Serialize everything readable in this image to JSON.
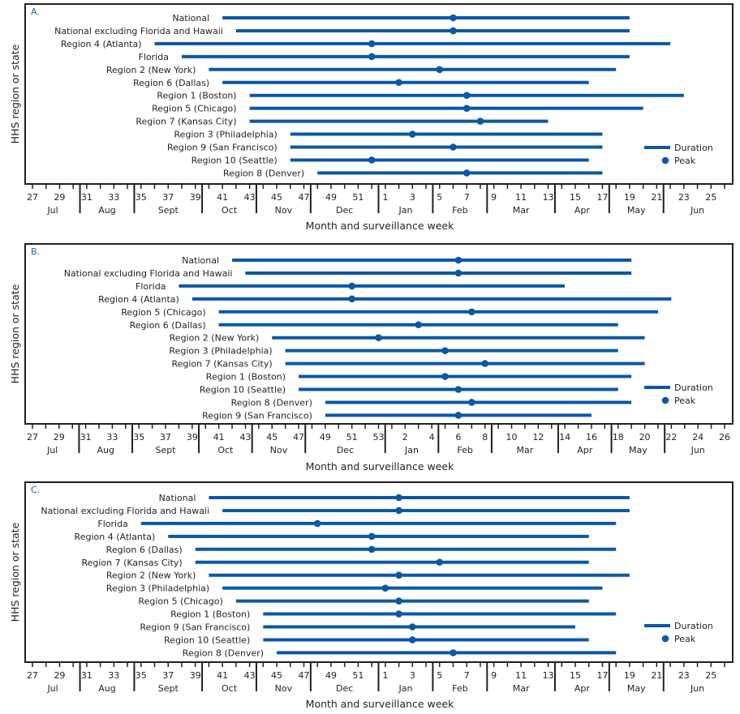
{
  "colors": {
    "series": "#0b58a4",
    "text": "#231f20",
    "panel_label": "#1f5fa8",
    "border": "#231f20"
  },
  "chart_data": [
    {
      "type": "range-dot",
      "panel_label": "A.",
      "ylabel": "HHS region or state",
      "xlabel": "Month and surveillance week",
      "weeks": [
        27,
        28,
        29,
        30,
        31,
        32,
        33,
        34,
        35,
        36,
        37,
        38,
        39,
        40,
        41,
        42,
        43,
        44,
        45,
        46,
        47,
        48,
        49,
        50,
        51,
        52,
        1,
        2,
        3,
        4,
        5,
        6,
        7,
        8,
        9,
        10,
        11,
        12,
        13,
        14,
        15,
        16,
        17,
        18,
        19,
        20,
        21,
        22,
        23,
        24,
        25,
        26
      ],
      "tick_labels": [
        "27",
        "29",
        "31",
        "33",
        "35",
        "37",
        "39",
        "41",
        "43",
        "45",
        "47",
        "49",
        "51",
        "1",
        "3",
        "5",
        "7",
        "9",
        "11",
        "13",
        "15",
        "17",
        "19",
        "21",
        "23",
        "25"
      ],
      "months": [
        {
          "label": "Jul",
          "first": 27,
          "last": 30
        },
        {
          "label": "Aug",
          "first": 31,
          "last": 34
        },
        {
          "label": "Sept",
          "first": 35,
          "last": 39
        },
        {
          "label": "Oct",
          "first": 40,
          "last": 43
        },
        {
          "label": "Nov",
          "first": 44,
          "last": 47
        },
        {
          "label": "Dec",
          "first": 48,
          "last": 52
        },
        {
          "label": "Jan",
          "first": 1,
          "last": 4
        },
        {
          "label": "Feb",
          "first": 5,
          "last": 8
        },
        {
          "label": "Mar",
          "first": 9,
          "last": 13
        },
        {
          "label": "Apr",
          "first": 14,
          "last": 17
        },
        {
          "label": "May",
          "first": 18,
          "last": 21
        },
        {
          "label": "Jun",
          "first": 22,
          "last": 26
        }
      ],
      "legend": {
        "duration": "Duration",
        "peak": "Peak",
        "position": "bottom-right"
      },
      "rows": [
        {
          "name": "National",
          "start": 41,
          "peak": 6,
          "end": 19
        },
        {
          "name": "National excluding Florida and Hawaii",
          "start": 42,
          "peak": 6,
          "end": 19
        },
        {
          "name": "Region 4 (Atlanta)",
          "start": 36,
          "peak": 52,
          "end": 22
        },
        {
          "name": "Florida",
          "start": 38,
          "peak": 52,
          "end": 19
        },
        {
          "name": "Region 2 (New York)",
          "start": 40,
          "peak": 5,
          "end": 18
        },
        {
          "name": "Region 6 (Dallas)",
          "start": 41,
          "peak": 2,
          "end": 16
        },
        {
          "name": "Region 1 (Boston)",
          "start": 43,
          "peak": 7,
          "end": 23
        },
        {
          "name": "Region 5 (Chicago)",
          "start": 43,
          "peak": 7,
          "end": 20
        },
        {
          "name": "Region 7 (Kansas City)",
          "start": 43,
          "peak": 8,
          "end": 13
        },
        {
          "name": "Region 3 (Philadelphia)",
          "start": 46,
          "peak": 3,
          "end": 17
        },
        {
          "name": "Region 9 (San Francisco)",
          "start": 46,
          "peak": 6,
          "end": 17
        },
        {
          "name": "Region 10 (Seattle)",
          "start": 46,
          "peak": 52,
          "end": 16
        },
        {
          "name": "Region 8 (Denver)",
          "start": 48,
          "peak": 7,
          "end": 17
        }
      ]
    },
    {
      "type": "range-dot",
      "panel_label": "B.",
      "ylabel": "HHS region or state",
      "xlabel": "Month and surveillance week",
      "weeks": [
        27,
        28,
        29,
        30,
        31,
        32,
        33,
        34,
        35,
        36,
        37,
        38,
        39,
        40,
        41,
        42,
        43,
        44,
        45,
        46,
        47,
        48,
        49,
        50,
        51,
        52,
        53,
        1,
        2,
        3,
        4,
        5,
        6,
        7,
        8,
        9,
        10,
        11,
        12,
        13,
        14,
        15,
        16,
        17,
        18,
        19,
        20,
        21,
        22,
        23,
        24,
        25,
        26
      ],
      "tick_labels": [
        "27",
        "29",
        "31",
        "33",
        "35",
        "37",
        "39",
        "41",
        "43",
        "45",
        "47",
        "49",
        "51",
        "53",
        "2",
        "4",
        "6",
        "8",
        "10",
        "12",
        "14",
        "16",
        "18",
        "20",
        "22",
        "24",
        "26"
      ],
      "months": [
        {
          "label": "Jul",
          "first": 27,
          "last": 30
        },
        {
          "label": "Aug",
          "first": 31,
          "last": 34
        },
        {
          "label": "Sept",
          "first": 35,
          "last": 39
        },
        {
          "label": "Oct",
          "first": 40,
          "last": 43
        },
        {
          "label": "Nov",
          "first": 44,
          "last": 47
        },
        {
          "label": "Dec",
          "first": 48,
          "last": 53
        },
        {
          "label": "Jan",
          "first": 1,
          "last": 4
        },
        {
          "label": "Feb",
          "first": 5,
          "last": 8
        },
        {
          "label": "Mar",
          "first": 9,
          "last": 13
        },
        {
          "label": "Apr",
          "first": 14,
          "last": 17
        },
        {
          "label": "May",
          "first": 18,
          "last": 21
        },
        {
          "label": "Jun",
          "first": 22,
          "last": 26
        }
      ],
      "legend": {
        "duration": "Duration",
        "peak": "Peak",
        "position": "bottom-right"
      },
      "rows": [
        {
          "name": "National",
          "start": 42,
          "peak": 6,
          "end": 19
        },
        {
          "name": "National excluding Florida and Hawaii",
          "start": 43,
          "peak": 6,
          "end": 19
        },
        {
          "name": "Florida",
          "start": 38,
          "peak": 51,
          "end": 14
        },
        {
          "name": "Region 4 (Atlanta)",
          "start": 39,
          "peak": 51,
          "end": 22
        },
        {
          "name": "Region 5 (Chicago)",
          "start": 41,
          "peak": 7,
          "end": 21
        },
        {
          "name": "Region 6 (Dallas)",
          "start": 41,
          "peak": 3,
          "end": 18
        },
        {
          "name": "Region 2 (New York)",
          "start": 45,
          "peak": 53,
          "end": 20
        },
        {
          "name": "Region 3 (Philadelphia)",
          "start": 46,
          "peak": 5,
          "end": 18
        },
        {
          "name": "Region 7 (Kansas City)",
          "start": 46,
          "peak": 8,
          "end": 20
        },
        {
          "name": "Region 1 (Boston)",
          "start": 47,
          "peak": 5,
          "end": 19
        },
        {
          "name": "Region 10 (Seattle)",
          "start": 47,
          "peak": 6,
          "end": 18
        },
        {
          "name": "Region 8 (Denver)",
          "start": 49,
          "peak": 7,
          "end": 19
        },
        {
          "name": "Region 9 (San Francisco)",
          "start": 49,
          "peak": 6,
          "end": 16
        }
      ]
    },
    {
      "type": "range-dot",
      "panel_label": "C.",
      "ylabel": "HHS region or state",
      "xlabel": "Month and surveillance week",
      "weeks": [
        27,
        28,
        29,
        30,
        31,
        32,
        33,
        34,
        35,
        36,
        37,
        38,
        39,
        40,
        41,
        42,
        43,
        44,
        45,
        46,
        47,
        48,
        49,
        50,
        51,
        52,
        1,
        2,
        3,
        4,
        5,
        6,
        7,
        8,
        9,
        10,
        11,
        12,
        13,
        14,
        15,
        16,
        17,
        18,
        19,
        20,
        21,
        22,
        23,
        24,
        25,
        26
      ],
      "tick_labels": [
        "27",
        "29",
        "31",
        "33",
        "35",
        "37",
        "39",
        "41",
        "43",
        "45",
        "47",
        "49",
        "51",
        "1",
        "3",
        "5",
        "7",
        "9",
        "11",
        "13",
        "15",
        "17",
        "19",
        "21",
        "23",
        "25"
      ],
      "months": [
        {
          "label": "Jul",
          "first": 27,
          "last": 30
        },
        {
          "label": "Aug",
          "first": 31,
          "last": 34
        },
        {
          "label": "Sept",
          "first": 35,
          "last": 39
        },
        {
          "label": "Oct",
          "first": 40,
          "last": 43
        },
        {
          "label": "Nov",
          "first": 44,
          "last": 47
        },
        {
          "label": "Dec",
          "first": 48,
          "last": 52
        },
        {
          "label": "Jan",
          "first": 1,
          "last": 4
        },
        {
          "label": "Feb",
          "first": 5,
          "last": 8
        },
        {
          "label": "Mar",
          "first": 9,
          "last": 13
        },
        {
          "label": "Apr",
          "first": 14,
          "last": 17
        },
        {
          "label": "May",
          "first": 18,
          "last": 21
        },
        {
          "label": "Jun",
          "first": 22,
          "last": 26
        }
      ],
      "legend": {
        "duration": "Duration",
        "peak": "Peak",
        "position": "bottom-right"
      },
      "rows": [
        {
          "name": "National",
          "start": 40,
          "peak": 2,
          "end": 19
        },
        {
          "name": "National excluding Florida and Hawaii",
          "start": 41,
          "peak": 2,
          "end": 19
        },
        {
          "name": "Florida",
          "start": 35,
          "peak": 48,
          "end": 18
        },
        {
          "name": "Region 4 (Atlanta)",
          "start": 37,
          "peak": 52,
          "end": 16
        },
        {
          "name": "Region 6 (Dallas)",
          "start": 39,
          "peak": 52,
          "end": 18
        },
        {
          "name": "Region 7 (Kansas City)",
          "start": 39,
          "peak": 5,
          "end": 16
        },
        {
          "name": "Region 2 (New York)",
          "start": 40,
          "peak": 2,
          "end": 19
        },
        {
          "name": "Region 3 (Philadelphia)",
          "start": 41,
          "peak": 1,
          "end": 17
        },
        {
          "name": "Region 5 (Chicago)",
          "start": 42,
          "peak": 2,
          "end": 16
        },
        {
          "name": "Region 1 (Boston)",
          "start": 44,
          "peak": 2,
          "end": 18
        },
        {
          "name": "Region 9 (San Francisco)",
          "start": 44,
          "peak": 3,
          "end": 15
        },
        {
          "name": "Region 10 (Seattle)",
          "start": 44,
          "peak": 3,
          "end": 16
        },
        {
          "name": "Region 8 (Denver)",
          "start": 45,
          "peak": 6,
          "end": 18
        }
      ]
    }
  ]
}
